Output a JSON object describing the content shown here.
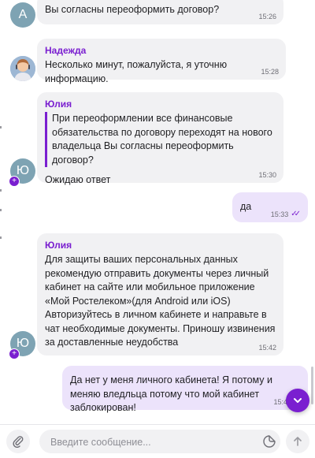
{
  "messages": [
    {
      "avatar_letter": "А",
      "text": "Вы согласны переоформить договор?",
      "time": "15:26"
    },
    {
      "sender": "Надежда",
      "text": "Несколько минут, пожалуйста, я уточню информацию.",
      "time": "15:28"
    },
    {
      "sender": "Юлия",
      "avatar_letter": "Ю",
      "quote": "При переоформлении все финансовые обязательства по договору переходят на нового владельца Вы согласны переоформить договор?",
      "text": "Ожидаю ответ",
      "time": "15:30"
    },
    {
      "text": "да",
      "time": "15:33"
    },
    {
      "sender": "Юлия",
      "avatar_letter": "Ю",
      "text_lines": [
        "Для защиты ваших персональных данных рекомендую отправить документы через личный кабинет на сайте или мобильное приложение «Мой Ростелеком»(для Android или iOS)",
        "Авторизуйтесь в личном кабинете и направьте в чат необходимые документы. Приношу извинения за доставленные неудобства"
      ],
      "time": "15:42"
    },
    {
      "text": "Да нет у меня личного кабинета! Я потому и меняю вледльца потому что мой кабинет заблокирован!",
      "time": "15:4"
    }
  ],
  "composer": {
    "placeholder": "Введите сообщение..."
  },
  "colors": {
    "accent": "#7a1fd0",
    "incoming_bubble": "#f1f1f3",
    "outgoing_bubble": "#ece3fb",
    "avatar_letter_bg": "#7ea3b3"
  },
  "icons": {
    "attach": "paperclip-icon",
    "emoji": "sticker-icon",
    "send": "arrow-up-icon",
    "scroll_down": "chevron-down-icon",
    "read": "double-check-icon",
    "avatar_badge": "plus-icon"
  }
}
